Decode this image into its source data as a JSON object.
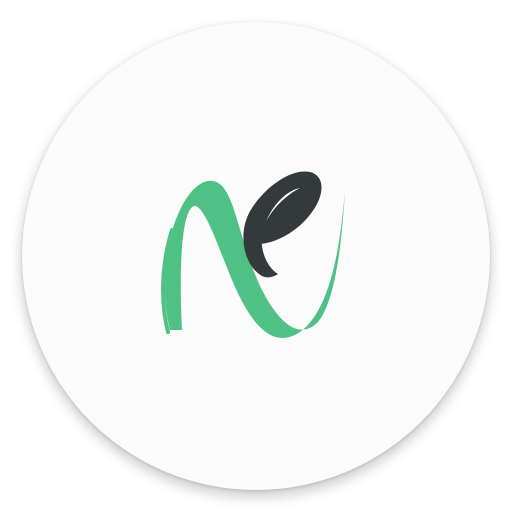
{
  "app_icon": {
    "name": "ne-logo-app-icon",
    "colors": {
      "background": "#fbfbfb",
      "green_ribbon": "#4fc184",
      "dark_leaf": "#34393c"
    },
    "icons": [
      "green-ribbon-icon",
      "dark-leaf-icon"
    ]
  }
}
